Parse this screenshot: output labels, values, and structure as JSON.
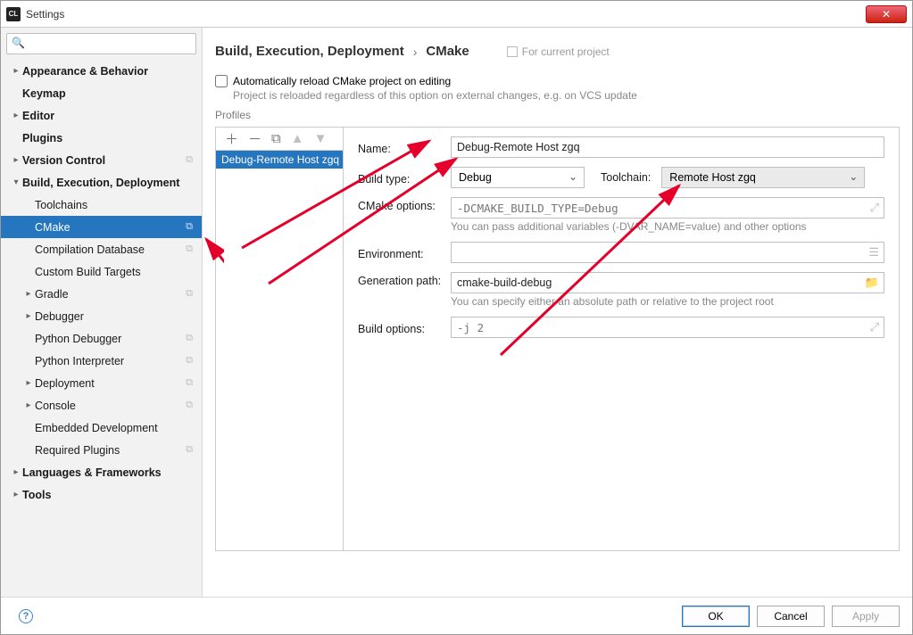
{
  "window": {
    "title": "Settings",
    "app_icon_text": "CL"
  },
  "sidebar": {
    "search_placeholder": "",
    "items": [
      {
        "label": "Appearance & Behavior",
        "bold": true,
        "depth": 0,
        "state": "collapsed"
      },
      {
        "label": "Keymap",
        "bold": true,
        "depth": 0,
        "state": "leaf"
      },
      {
        "label": "Editor",
        "bold": true,
        "depth": 0,
        "state": "collapsed"
      },
      {
        "label": "Plugins",
        "bold": true,
        "depth": 0,
        "state": "leaf"
      },
      {
        "label": "Version Control",
        "bold": true,
        "depth": 0,
        "state": "collapsed",
        "badge": "⧉"
      },
      {
        "label": "Build, Execution, Deployment",
        "bold": true,
        "depth": 0,
        "state": "expanded"
      },
      {
        "label": "Toolchains",
        "bold": false,
        "depth": 1,
        "state": "leaf"
      },
      {
        "label": "CMake",
        "bold": false,
        "depth": 1,
        "state": "leaf",
        "selected": true,
        "badge": "⧉"
      },
      {
        "label": "Compilation Database",
        "bold": false,
        "depth": 1,
        "state": "leaf",
        "badge": "⧉"
      },
      {
        "label": "Custom Build Targets",
        "bold": false,
        "depth": 1,
        "state": "leaf"
      },
      {
        "label": "Gradle",
        "bold": false,
        "depth": 1,
        "state": "collapsed",
        "badge": "⧉"
      },
      {
        "label": "Debugger",
        "bold": false,
        "depth": 1,
        "state": "collapsed"
      },
      {
        "label": "Python Debugger",
        "bold": false,
        "depth": 1,
        "state": "leaf",
        "badge": "⧉"
      },
      {
        "label": "Python Interpreter",
        "bold": false,
        "depth": 1,
        "state": "leaf",
        "badge": "⧉"
      },
      {
        "label": "Deployment",
        "bold": false,
        "depth": 1,
        "state": "collapsed",
        "badge": "⧉"
      },
      {
        "label": "Console",
        "bold": false,
        "depth": 1,
        "state": "collapsed",
        "badge": "⧉"
      },
      {
        "label": "Embedded Development",
        "bold": false,
        "depth": 1,
        "state": "leaf"
      },
      {
        "label": "Required Plugins",
        "bold": false,
        "depth": 1,
        "state": "leaf",
        "badge": "⧉"
      },
      {
        "label": "Languages & Frameworks",
        "bold": true,
        "depth": 0,
        "state": "collapsed"
      },
      {
        "label": "Tools",
        "bold": true,
        "depth": 0,
        "state": "collapsed"
      }
    ]
  },
  "breadcrumb": {
    "root": "Build, Execution, Deployment",
    "leaf": "CMake",
    "hint": "For current project"
  },
  "auto_reload": {
    "checkbox_label": "Automatically reload CMake project on editing",
    "hint": "Project is reloaded regardless of this option on external changes, e.g. on VCS update"
  },
  "profiles": {
    "group_label": "Profiles",
    "list": [
      "Debug-Remote Host zgq"
    ],
    "form": {
      "name": {
        "label": "Name:",
        "value": "Debug-Remote Host zgq"
      },
      "build_type": {
        "label": "Build type:",
        "value": "Debug"
      },
      "toolchain": {
        "label": "Toolchain:",
        "value": "Remote Host zgq"
      },
      "cmake_options": {
        "label": "CMake options:",
        "placeholder": "-DCMAKE_BUILD_TYPE=Debug",
        "hint": "You can pass additional variables (-DVAR_NAME=value) and other options"
      },
      "environment": {
        "label": "Environment:",
        "value": ""
      },
      "generation_path": {
        "label": "Generation path:",
        "value": "cmake-build-debug",
        "hint": "You can specify either an absolute path or relative to the project root"
      },
      "build_options": {
        "label": "Build options:",
        "placeholder": "-j 2"
      }
    }
  },
  "footer": {
    "ok": "OK",
    "cancel": "Cancel",
    "apply": "Apply"
  }
}
